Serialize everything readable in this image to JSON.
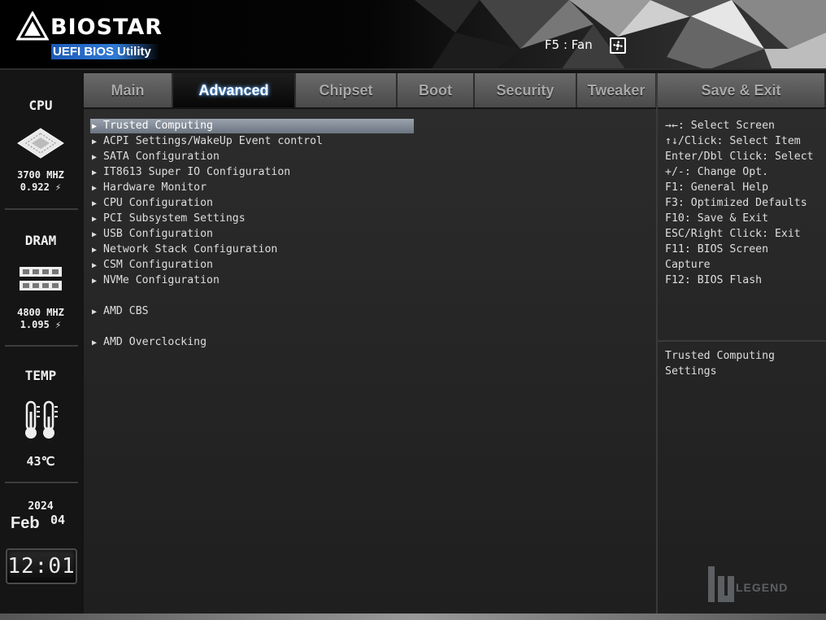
{
  "header": {
    "brand": "BIOSTAR",
    "subtitle": "UEFI BIOS Utility",
    "fan_hint": "F5 : Fan",
    "fan_icon": "fan-icon"
  },
  "sidebar": {
    "cpu": {
      "title": "CPU",
      "frequency": "3700 MHZ",
      "voltage": "0.922 ⚡"
    },
    "dram": {
      "title": "DRAM",
      "frequency": "4800 MHZ",
      "voltage": "1.095 ⚡"
    },
    "temp": {
      "title": "TEMP",
      "value": "43℃"
    },
    "date": {
      "year": "2024",
      "month": "Feb",
      "day": "04"
    },
    "time": "12:01"
  },
  "tabs": [
    {
      "label": "Main"
    },
    {
      "label": "Advanced"
    },
    {
      "label": "Chipset"
    },
    {
      "label": "Boot"
    },
    {
      "label": "Security"
    },
    {
      "label": "Tweaker"
    },
    {
      "label": "Save & Exit"
    }
  ],
  "active_tab": "Advanced",
  "menu": {
    "items": [
      {
        "label": "Trusted Computing"
      },
      {
        "label": "ACPI Settings/WakeUp Event control"
      },
      {
        "label": "SATA Configuration"
      },
      {
        "label": "IT8613 Super IO Configuration"
      },
      {
        "label": "Hardware Monitor"
      },
      {
        "label": "CPU Configuration"
      },
      {
        "label": "PCI Subsystem Settings"
      },
      {
        "label": "USB Configuration"
      },
      {
        "label": "Network Stack Configuration"
      },
      {
        "label": "CSM Configuration"
      },
      {
        "label": "NVMe Configuration"
      },
      {
        "label": "AMD CBS"
      },
      {
        "label": "AMD Overclocking"
      }
    ],
    "selected": "Trusted Computing",
    "arrow_glyph": "▶"
  },
  "help": {
    "keys": [
      "→←: Select Screen",
      "↑↓/Click: Select Item",
      "Enter/Dbl Click: Select",
      "+/-: Change Opt.",
      "F1: General Help",
      "F3: Optimized Defaults",
      "F10: Save & Exit",
      "ESC/Right Click: Exit",
      "F11: BIOS Screen",
      "Capture",
      "F12: BIOS Flash"
    ],
    "description": [
      "Trusted Computing",
      "Settings"
    ]
  },
  "watermark": {
    "text": "LEGEND"
  },
  "colors": {
    "accent": "#2f7bd6",
    "selected_bg": "#8a939e",
    "tab_glow": "#6fb9ff"
  }
}
